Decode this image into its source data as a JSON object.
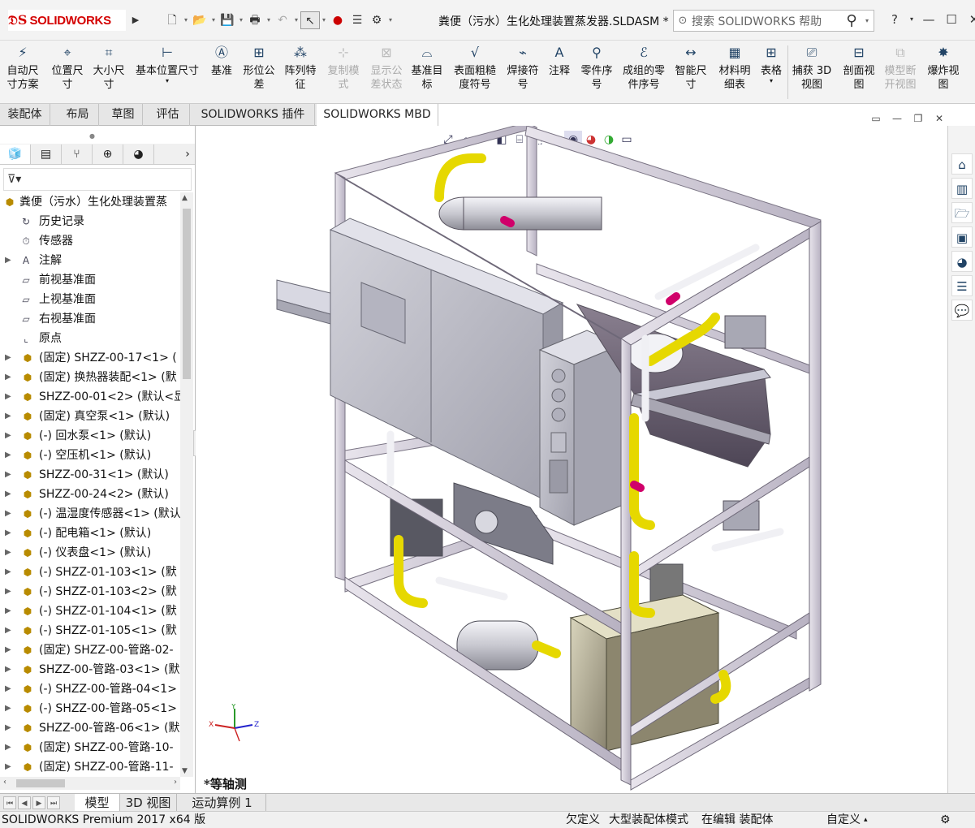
{
  "app": {
    "logo": "SOLIDWORKS",
    "document_title": "粪便（污水）生化处理装置蒸发器.SLDASM *",
    "search_placeholder": "搜索 SOLIDWORKS 帮助",
    "help_label": "?",
    "accent_color": "#d40000"
  },
  "quick_access": [
    "new-icon",
    "open-icon",
    "save-icon",
    "print-icon",
    "undo-icon",
    "select-icon",
    "rebuild-icon",
    "file-properties-icon",
    "options-icon"
  ],
  "command_manager": [
    {
      "label1": "自动尺",
      "label2": "寸方案",
      "enabled": true
    },
    {
      "label1": "位置尺",
      "label2": "寸",
      "enabled": true
    },
    {
      "label1": "大小尺",
      "label2": "寸",
      "enabled": true
    },
    {
      "label1": "基本位置尺寸",
      "label2": "",
      "enabled": true
    },
    {
      "label1": "基准",
      "label2": "",
      "enabled": true
    },
    {
      "label1": "形位公",
      "label2": "差",
      "enabled": true
    },
    {
      "label1": "阵列特",
      "label2": "征",
      "enabled": true
    },
    {
      "label1": "复制模",
      "label2": "式",
      "enabled": false
    },
    {
      "label1": "显示公",
      "label2": "差状态",
      "enabled": false
    },
    {
      "label1": "基准目",
      "label2": "标",
      "enabled": true
    },
    {
      "label1": "表面粗糙",
      "label2": "度符号",
      "enabled": true
    },
    {
      "label1": "焊接符",
      "label2": "号",
      "enabled": true
    },
    {
      "label1": "注释",
      "label2": "",
      "enabled": true
    },
    {
      "label1": "零件序",
      "label2": "号",
      "enabled": true
    },
    {
      "label1": "成组的零",
      "label2": "件序号",
      "enabled": true
    },
    {
      "label1": "智能尺",
      "label2": "寸",
      "enabled": true
    },
    {
      "label1": "材料明",
      "label2": "细表",
      "enabled": true
    },
    {
      "label1": "表格",
      "label2": "",
      "enabled": true
    },
    {
      "label1": "捕获 3D",
      "label2": "视图",
      "enabled": true
    },
    {
      "label1": "剖面视",
      "label2": "图",
      "enabled": true
    },
    {
      "label1": "模型断",
      "label2": "开视图",
      "enabled": false
    },
    {
      "label1": "爆炸视",
      "label2": "图",
      "enabled": true
    }
  ],
  "tabs": [
    "装配体",
    "布局",
    "草图",
    "评估",
    "SOLIDWORKS 插件",
    "SOLIDWORKS MBD"
  ],
  "active_tab": "SOLIDWORKS MBD",
  "feature_tree": {
    "root": "粪便（污水）生化处理装置蒸",
    "items": [
      {
        "label": "历史记录",
        "expand": false
      },
      {
        "label": "传感器",
        "expand": false
      },
      {
        "label": "注解",
        "expand": true
      },
      {
        "label": "前视基准面",
        "expand": false
      },
      {
        "label": "上视基准面",
        "expand": false
      },
      {
        "label": "右视基准面",
        "expand": false
      },
      {
        "label": "原点",
        "expand": false
      },
      {
        "label": "(固定) SHZZ-00-17<1> (",
        "expand": true
      },
      {
        "label": "(固定) 换热器装配<1> (默",
        "expand": true
      },
      {
        "label": "SHZZ-00-01<2> (默认<显",
        "expand": true
      },
      {
        "label": "(固定) 真空泵<1> (默认)",
        "expand": true
      },
      {
        "label": "(-) 回水泵<1> (默认)",
        "expand": true
      },
      {
        "label": "(-) 空压机<1> (默认)",
        "expand": true
      },
      {
        "label": "SHZZ-00-31<1> (默认)",
        "expand": true
      },
      {
        "label": "SHZZ-00-24<2> (默认)",
        "expand": true
      },
      {
        "label": "(-) 温湿度传感器<1> (默认",
        "expand": true
      },
      {
        "label": "(-) 配电箱<1> (默认)",
        "expand": true
      },
      {
        "label": "(-) 仪表盘<1> (默认)",
        "expand": true
      },
      {
        "label": "(-) SHZZ-01-103<1> (默",
        "expand": true
      },
      {
        "label": "(-) SHZZ-01-103<2> (默",
        "expand": true
      },
      {
        "label": "(-) SHZZ-01-104<1> (默",
        "expand": true
      },
      {
        "label": "(-) SHZZ-01-105<1> (默",
        "expand": true
      },
      {
        "label": "(固定) SHZZ-00-管路-02-",
        "expand": true
      },
      {
        "label": "SHZZ-00-管路-03<1> (默",
        "expand": true
      },
      {
        "label": "(-) SHZZ-00-管路-04<1>",
        "expand": true
      },
      {
        "label": "(-) SHZZ-00-管路-05<1>",
        "expand": true
      },
      {
        "label": "SHZZ-00-管路-06<1> (默",
        "expand": true
      },
      {
        "label": "(固定) SHZZ-00-管路-10-",
        "expand": true
      },
      {
        "label": "(固定) SHZZ-00-管路-11-",
        "expand": true
      }
    ]
  },
  "view_label": "*等轴测",
  "triad": {
    "x": "X",
    "y": "Y",
    "z": "Z"
  },
  "bottom_tabs": [
    "模型",
    "3D 视图",
    "运动算例 1"
  ],
  "active_bottom_tab": "模型",
  "status": {
    "product": "SOLIDWORKS Premium 2017 x64 版",
    "underdefined": "欠定义",
    "large_assembly": "大型装配体模式",
    "editing": "在编辑 装配体",
    "custom": "自定义"
  }
}
